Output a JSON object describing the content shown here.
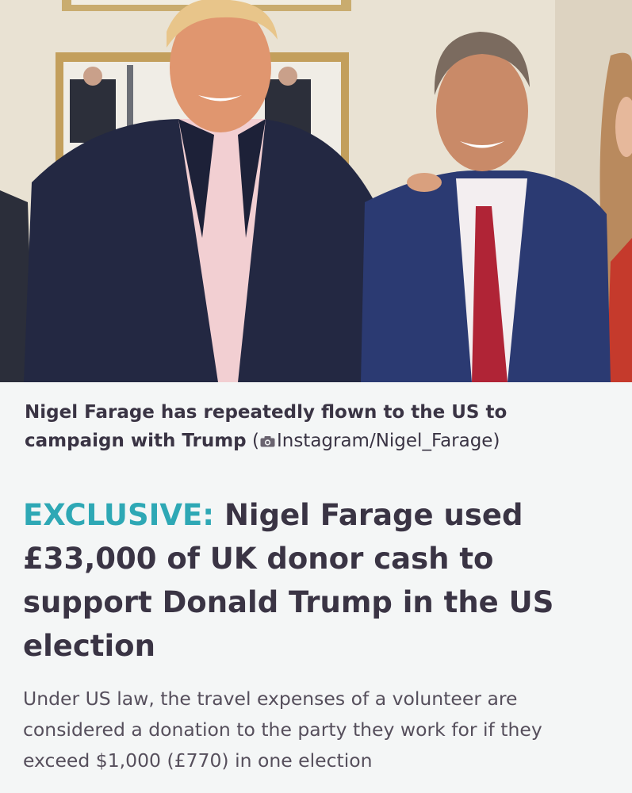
{
  "photo": {
    "description_icon": "photo-image"
  },
  "caption": {
    "text": "Nigel Farage has repeatedly flown to the US to campaign with Trump",
    "credit_open": "(",
    "credit_icon": "camera-icon",
    "credit_source": "Instagram/Nigel_Farage",
    "credit_close": ")"
  },
  "article": {
    "tag": "EXCLUSIVE:",
    "headline": "Nigel Farage used £33,000 of UK donor cash to support Donald Trump in the US election",
    "standfirst": "Under US law, the travel expenses of a volunteer are considered a donation to the party they work for if they exceed $1,000 (£770) in one election"
  },
  "colors": {
    "accent": "#2ea8b5",
    "headline": "#3a3444",
    "body": "#564f5c",
    "background": "#f4f6f6"
  }
}
